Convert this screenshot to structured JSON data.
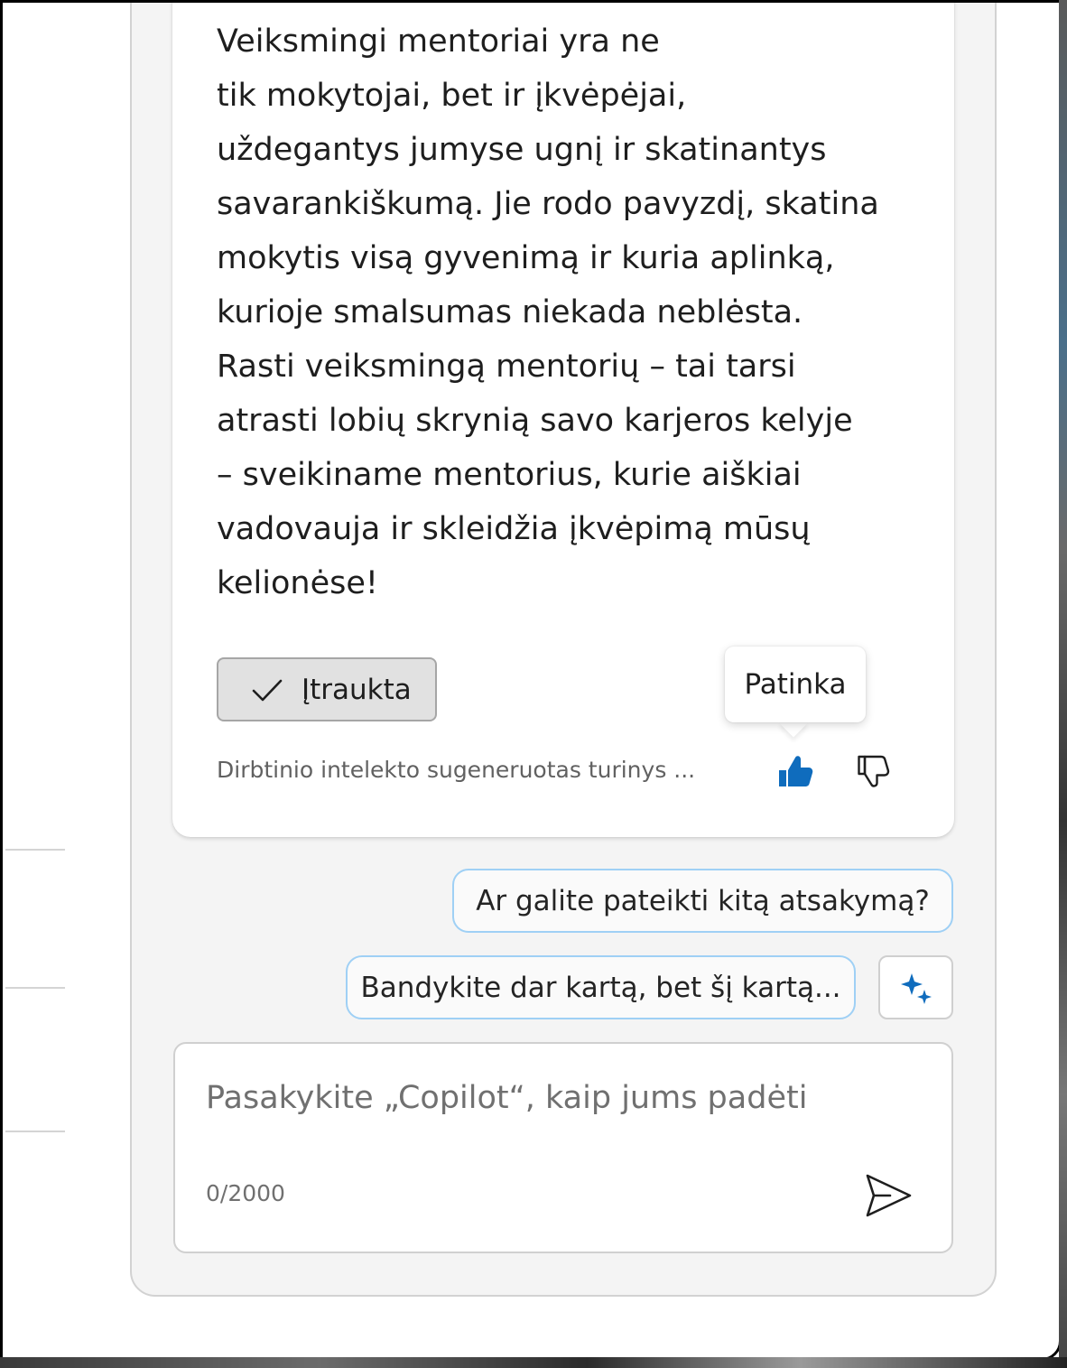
{
  "message": {
    "lines": [
      "Veiksmingi mentoriai yra ne",
      "tik mokytojai, bet ir įkvėpėjai,",
      "uždegantys jumyse ugnį ir skatinantys",
      "savarankiškumą. Jie rodo pavyzdį, skatina",
      "mokytis visą gyvenimą ir kuria aplinką,",
      "kurioje smalsumas niekada neblėsta.",
      "Rasti veiksmingą mentorių – tai tarsi",
      "atrasti lobių skrynią savo karjeros kelyje",
      "– sveikiname mentorius, kurie aiškiai",
      "vadovauja ir skleidžia įkvėpimą mūsų",
      "kelionėse!"
    ]
  },
  "actions": {
    "included_label": "Įtraukta",
    "ai_disclaimer": "Dirbtinio intelekto sugeneruotas turinys ...",
    "like_tooltip": "Patinka"
  },
  "suggestions": [
    "Ar galite pateikti kitą atsakymą?",
    "Bandykite dar kartą, bet šį kartą..."
  ],
  "compose": {
    "placeholder": "Pasakykite „Copilot“, kaip jums padėti",
    "char_count": "0/2000"
  },
  "colors": {
    "accent": "#0f6cbd",
    "suggestion_border": "#9fd0f5",
    "pane_bg": "#f4f4f4"
  },
  "icons": {
    "included": "checkmark-icon",
    "like": "thumbs-up-filled-icon",
    "dislike": "thumbs-down-icon",
    "sparkle": "sparkle-icon",
    "send": "send-icon"
  }
}
